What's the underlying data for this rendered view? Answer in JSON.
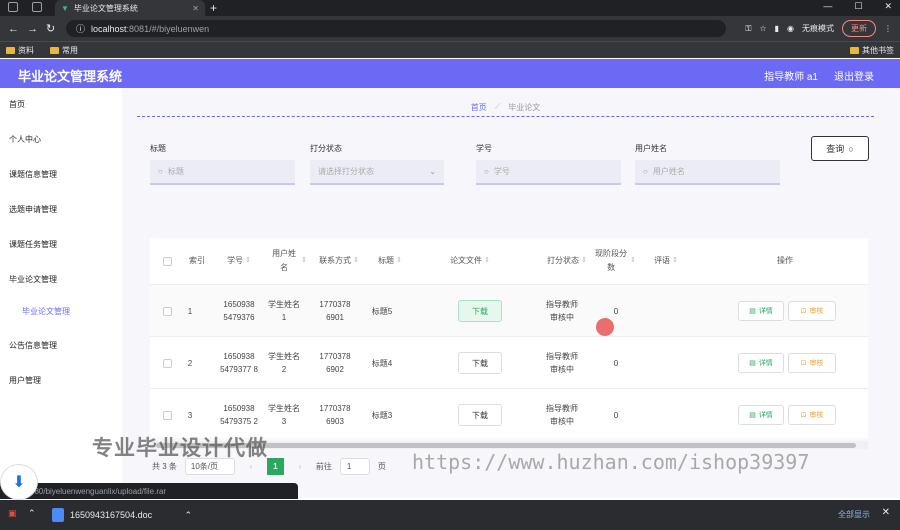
{
  "browser": {
    "tab_title": "毕业论文管理系统",
    "url_host": "localhost",
    "url_rest": ":8081/#/biyeluenwen",
    "profile": "无痕模式",
    "update": "更新",
    "bookmarks": [
      "资料",
      "常用"
    ],
    "other_bookmarks": "其他书签"
  },
  "header": {
    "brand": "毕业论文管理系统",
    "user": "指导教师 a1",
    "logout": "退出登录"
  },
  "sidebar": {
    "items": [
      "首页",
      "个人中心",
      "课题信息管理",
      "选题申请管理",
      "课题任务管理",
      "毕业论文管理",
      "毕业论文管理",
      "公告信息管理",
      "用户管理"
    ]
  },
  "breadcrumb": {
    "home": "首页",
    "current": "毕业论文"
  },
  "search": {
    "title_label": "标题",
    "title_placeholder": "标题",
    "status_label": "打分状态",
    "status_placeholder": "请选择打分状态",
    "sid_label": "学号",
    "sid_placeholder": "学号",
    "uname_label": "用户姓名",
    "uname_placeholder": "用户姓名",
    "query": "查询"
  },
  "table": {
    "headers": [
      "索引",
      "学号",
      "用户姓名",
      "联系方式",
      "标题",
      "论文文件",
      "打分状态",
      "现阶段分数",
      "评语",
      "操作"
    ],
    "rows": [
      {
        "index": "1",
        "sid": "1650938 5479376",
        "name": "学生姓名 1",
        "phone": "1770378 6901",
        "title": "标题5",
        "file": "下载",
        "status": "指导教师 审核中",
        "score": "0"
      },
      {
        "index": "2",
        "sid": "1650938 5479377 8",
        "name": "学生姓名 2",
        "phone": "1770378 6902",
        "title": "标题4",
        "file": "下载",
        "status": "指导教师 审核中",
        "score": "0"
      },
      {
        "index": "3",
        "sid": "1650938 5479375 2",
        "name": "学生姓名 3",
        "phone": "1770378 6903",
        "title": "标题3",
        "file": "下载",
        "status": "指导教师 审核中",
        "score": "0"
      }
    ],
    "detail": "详情",
    "review": "审核"
  },
  "pager": {
    "total": "共 3 条",
    "size": "10条/页",
    "page": "1",
    "goto": "前往",
    "goto_val": "1",
    "unit": "页"
  },
  "watermark": {
    "left": "专业毕业设计代做",
    "right": "https://www.huzhan.com/ishop39397"
  },
  "status_url": "080/biyeluenwenguanlix/upload/file.rar",
  "download": {
    "filename": "1650943167504.doc",
    "show_all": "全部显示"
  }
}
